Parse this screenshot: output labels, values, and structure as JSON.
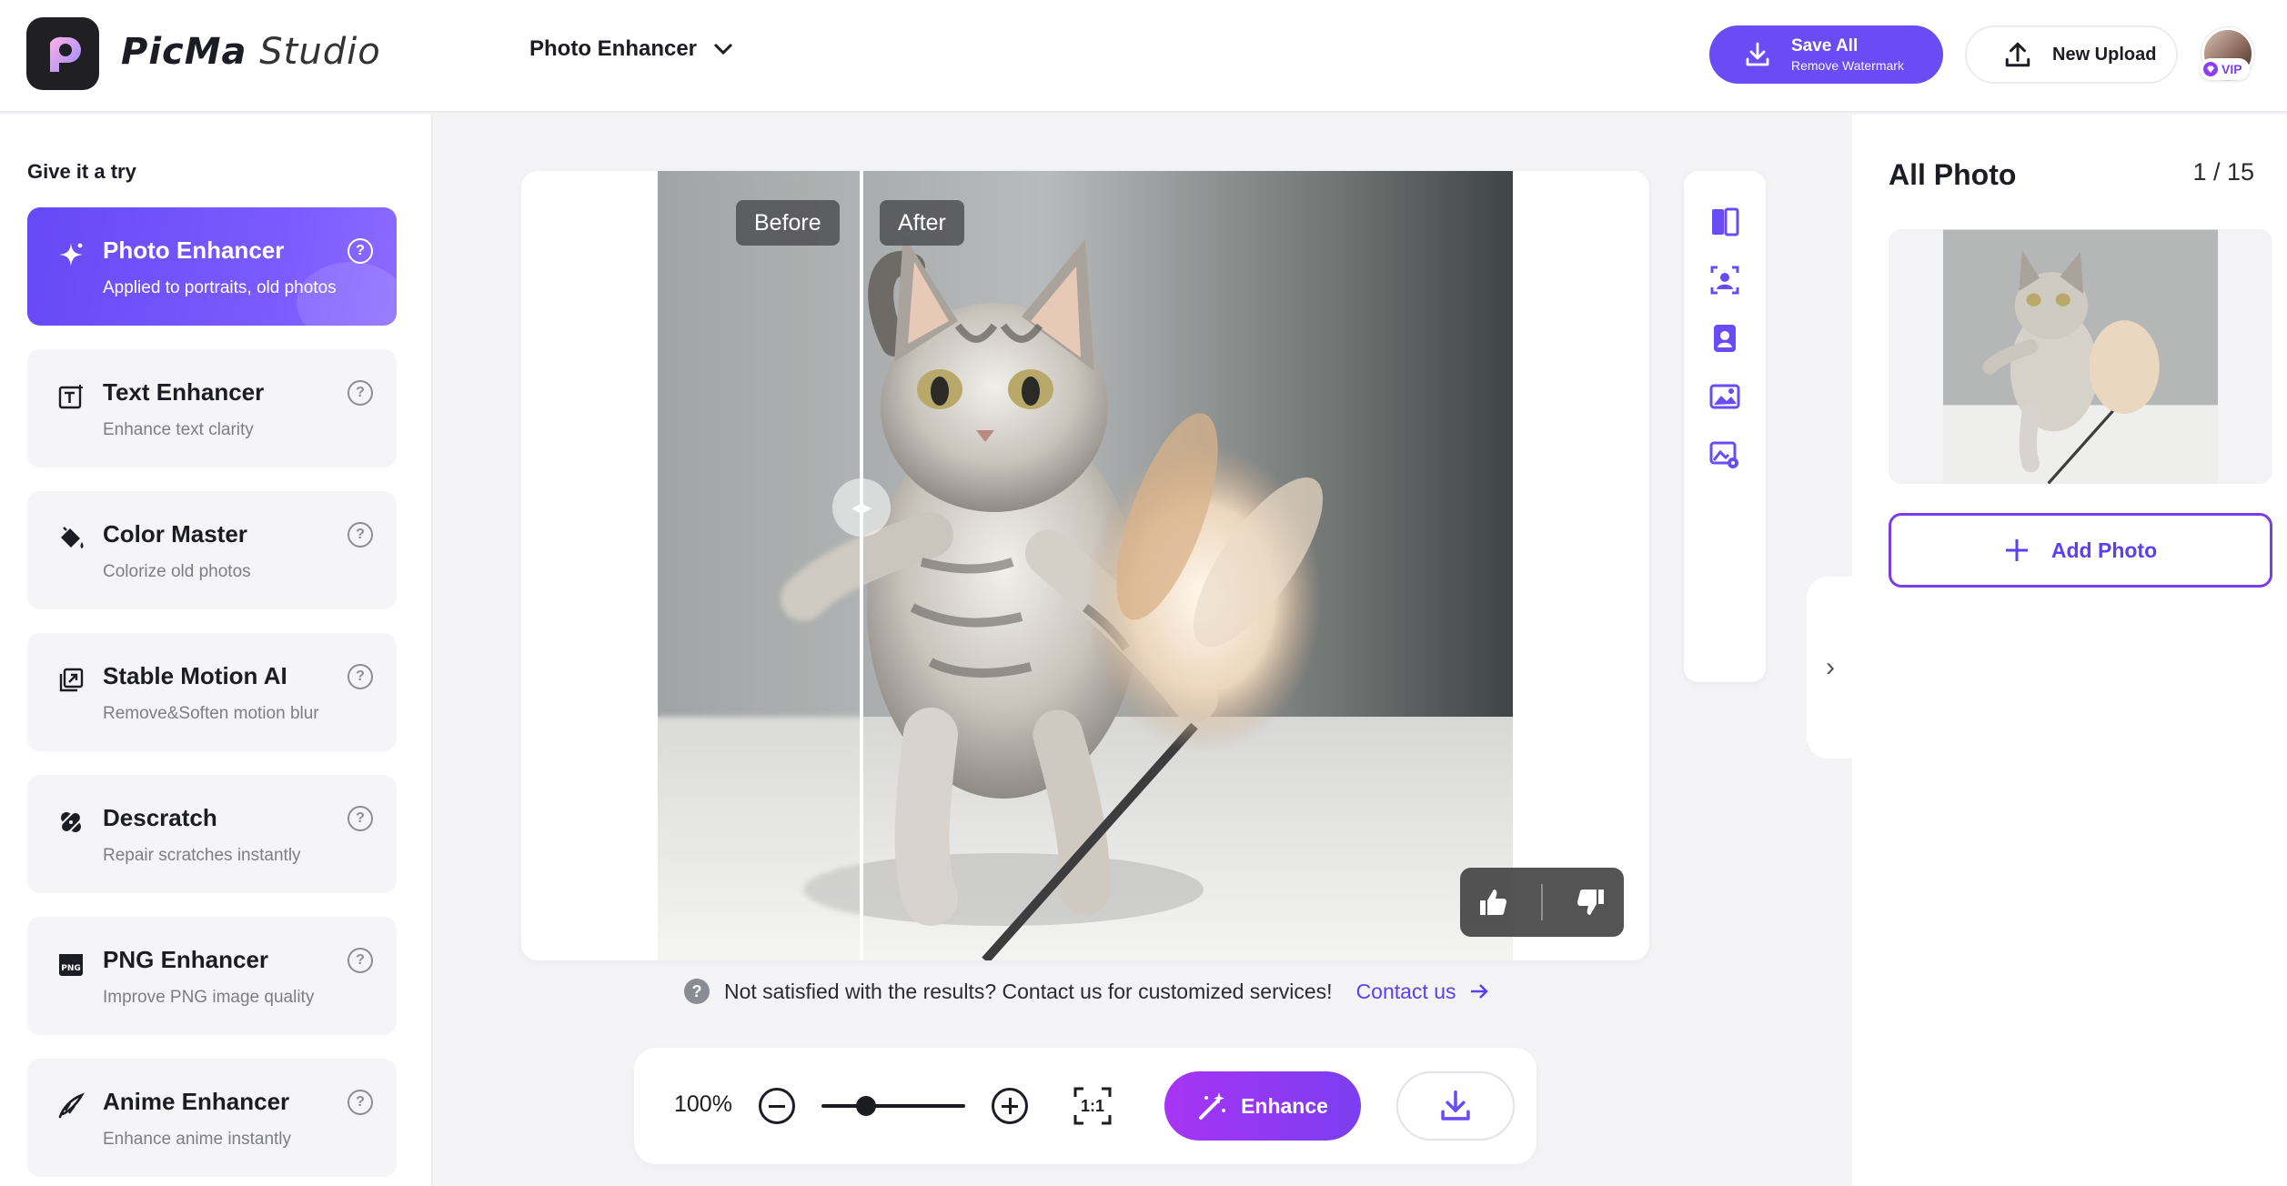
{
  "app": {
    "brand_bold": "PicMa",
    "brand_light": " Studio",
    "mode_label": "Photo Enhancer"
  },
  "header": {
    "save_all_label": "Save All",
    "save_all_sub": "Remove Watermark",
    "new_upload_label": "New Upload",
    "vip_label": "VIP"
  },
  "sidebar": {
    "heading": "Give it a try",
    "tools": [
      {
        "name": "Photo Enhancer",
        "desc": "Applied to portraits, old photos",
        "icon": "sparkle-icon",
        "active": true
      },
      {
        "name": "Text Enhancer",
        "desc": "Enhance text clarity",
        "icon": "text-icon"
      },
      {
        "name": "Color Master",
        "desc": "Colorize old photos",
        "icon": "paint-bucket-icon"
      },
      {
        "name": "Stable Motion AI",
        "desc": "Remove&Soften motion blur",
        "icon": "motion-icon"
      },
      {
        "name": "Descratch",
        "desc": "Repair scratches instantly",
        "icon": "bandage-icon"
      },
      {
        "name": "PNG Enhancer",
        "desc": "Improve PNG image quality",
        "icon": "png-icon"
      },
      {
        "name": "Anime Enhancer",
        "desc": "Enhance anime instantly",
        "icon": "brush-icon"
      }
    ],
    "help_glyph": "?"
  },
  "canvas": {
    "before_label": "Before",
    "after_label": "After",
    "comparison_split": 0.24
  },
  "notice": {
    "text": "Not satisfied with the results? Contact us for customized services!",
    "contact_label": "Contact us"
  },
  "toolbar": {
    "zoom_value": "100%",
    "fit_label": "1:1",
    "enhance_label": "Enhance",
    "zoom_slider_level": 0.29
  },
  "right_panel": {
    "title": "All Photo",
    "count": "1 / 15",
    "add_photo_label": "Add Photo"
  },
  "colors": {
    "accent": "#6a4cf5",
    "enhance_gradient_start": "#a734f5",
    "enhance_gradient_end": "#7b3ef0"
  }
}
